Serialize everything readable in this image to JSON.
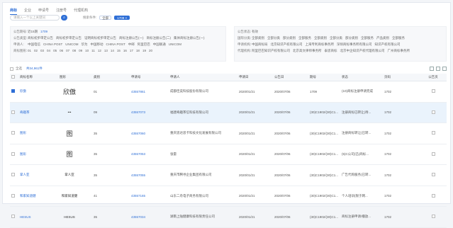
{
  "tabs": [
    "商标",
    "企业",
    "申请号",
    "注册号",
    "代理机构"
  ],
  "search": {
    "placeholder": "请输入一个以上关键词",
    "btn": "⌕",
    "label": "搜索条件:",
    "chip1": "全部",
    "chip2": "1709 ×"
  },
  "filters_left": [
    {
      "k": "公告期号:",
      "vals": [
        "近15期",
        "1709"
      ]
    },
    {
      "k": "公告类型:",
      "vals": [
        "商标初步审定公告",
        "商标初步审定公告",
        "证明商标初步审定公告",
        "商标注册公告(一)",
        "商标注册公告(二)",
        "集体商标注册公告(一)"
      ]
    },
    {
      "k": "申请人:",
      "vals": [
        "中国电信",
        "CHINA POST",
        "UNICOM",
        "华为",
        "中国移动",
        "CHINA POST",
        "中邮",
        "阿里巴巴",
        "中国联通",
        "UNICOM"
      ]
    },
    {
      "k": "商标图形:",
      "vals": [
        "01",
        "02",
        "03",
        "04",
        "05",
        "06",
        "07",
        "08",
        "09",
        "10",
        "11",
        "12",
        "13",
        "14",
        "15",
        "16",
        "17",
        "18",
        "19",
        "20"
      ]
    }
  ],
  "filters_right": [
    {
      "k": "公告状态:",
      "vals": [
        "有效"
      ]
    },
    {
      "k": "国际分类:",
      "vals": [
        "全部类别",
        "全部分类",
        "部分类别",
        "全部服务",
        "全部类别",
        "全部分类",
        "部分类别",
        "全部服务",
        "产品类别",
        "全部服务"
      ]
    },
    {
      "k": "申请机构:",
      "vals": [
        "中国商标局",
        "北京知识产权有限公司",
        "上海专利商标事务所",
        "深圳商标事务所有限公司",
        "知识产权有限公司"
      ]
    },
    {
      "k": "代理机构:",
      "vals": [
        "阿里巴巴知识产权有限公司",
        "北京高文律师事务所",
        "泰思商标",
        "北京中企知识产权代理有限公司",
        "广州商标事务所"
      ]
    }
  ],
  "toolbar": {
    "all": "全选",
    "count": "共34,961件",
    "export": "导出"
  },
  "columns": [
    "",
    "商标名称",
    "图形",
    "类别",
    "申请号",
    "申请人",
    "申请日",
    "公告日",
    "期号",
    "状态",
    "页码",
    "公告页"
  ],
  "rows": [
    {
      "checked": true,
      "name": "欣傲",
      "logo": "欣傲",
      "cls": "01",
      "no": "43557861",
      "applicant": "成都佳奕科技股份有限公司",
      "adate": "2020/01/21",
      "pdate": "2020/07/06",
      "issue": "1709",
      "status": "(10)商标注册申请完成",
      "page": "1702"
    },
    {
      "checked": false,
      "name": "奇趣茶",
      "logo": "•••",
      "cls": "09",
      "no": "43557073",
      "applicant": "福建奇趣茶信科技有限公司",
      "adate": "2020/01/21",
      "pdate": "2020/07/06",
      "issue": "(30)C1902/(30)C1...",
      "status": "注册商标已转让(待...",
      "page": "1702"
    },
    {
      "checked": false,
      "name": "图形",
      "logo": "图",
      "cls": "35",
      "no": "43557060",
      "applicant": "重庆思达思卡科技文化发展有限公司",
      "adate": "2020/01/21",
      "pdate": "2020/07/06",
      "issue": "(30)C1902/(30)C1...",
      "status": "注册商标转让(已转...",
      "page": "1702"
    },
    {
      "checked": false,
      "name": "图形",
      "logo": "图",
      "cls": "35",
      "no": "43557053",
      "applicant": "张雷",
      "adate": "2020/01/21",
      "pdate": "2020/07/06",
      "issue": "(30)C1902/(30)C1...",
      "status": "(5)C公司(已)商标...",
      "page": "1702"
    },
    {
      "checked": false,
      "name": "掌人亚",
      "logo": "掌人亚",
      "cls": "35",
      "no": "43557055",
      "applicant": "重庆市腾寻企业集团有限公司",
      "adate": "2020/01/21",
      "pdate": "2020/07/06",
      "issue": "(30)C1902/(30)C1...",
      "status": "广告代购服务(已转...",
      "page": "1702"
    },
    {
      "checked": false,
      "name": "和家知道健",
      "logo": "和家知道健",
      "cls": "41",
      "no": "43557165",
      "applicant": "山东二舟电子商务有限公司",
      "adate": "2020/01/21",
      "pdate": "2020/07/06",
      "issue": "(30)C1902/(30)C1...",
      "status": "个人培训(限于网...",
      "page": "1702"
    },
    {
      "checked": false,
      "name": "HESUS",
      "logo": "HESUS",
      "cls": "35",
      "no": "43557034",
      "applicant": "湖南上陆健康科技有限责任公司",
      "adate": "2020/01/21",
      "pdate": "2020/07/06",
      "issue": "(30)C1902/(30)C1...",
      "status": "商标注册申请/播放...",
      "page": "1702"
    }
  ]
}
